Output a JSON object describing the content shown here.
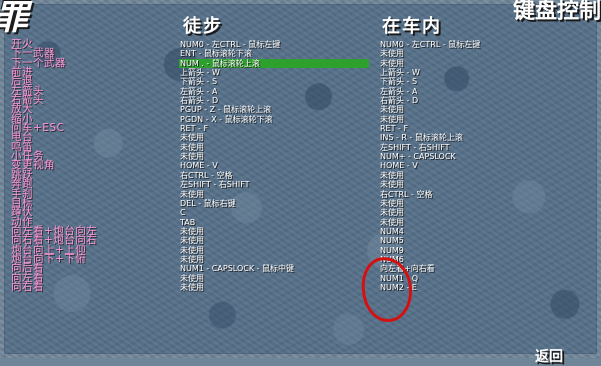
{
  "logo_text": "罪",
  "corner_title": "键盘控制",
  "headers": {
    "on_foot": "徒步",
    "in_vehicle": "在车内"
  },
  "back_label": "返回",
  "colors": {
    "action_text": "#ff96dc",
    "key_text": "#ffffff",
    "selection_highlight": "#2ea02e",
    "annotation_circle": "#d41010"
  },
  "bindings": [
    {
      "action": "开火",
      "on_foot": "NUM0 - 左CTRL - 鼠标左键",
      "in_vehicle": "NUM0 - 左CTRL - 鼠标左键"
    },
    {
      "action": "下一武器",
      "on_foot": "ENT - 鼠标滚轮下滚",
      "in_vehicle": "未使用"
    },
    {
      "action": "下一个武器",
      "on_foot": "NUM . - 鼠标滚轮上滚",
      "in_vehicle": "未使用"
    },
    {
      "action": "前进",
      "on_foot": "上箭头 - W",
      "in_vehicle": "上箭头 - W"
    },
    {
      "action": "后退",
      "on_foot": "下箭头 - S",
      "in_vehicle": "下箭头 - S"
    },
    {
      "action": "左箭头",
      "on_foot": "左箭头 - A",
      "in_vehicle": "左箭头 - A"
    },
    {
      "action": "右箭头",
      "on_foot": "右箭头 - D",
      "in_vehicle": "右箭头 - D"
    },
    {
      "action": "放大",
      "on_foot": "PGUP - Z - 鼠标滚轮上滚",
      "in_vehicle": "未使用"
    },
    {
      "action": "缩小",
      "on_foot": "PGDN - X - 鼠标滚轮下滚",
      "in_vehicle": "未使用"
    },
    {
      "action": "问车+ESC",
      "on_foot": "RET - F",
      "in_vehicle": "RET - F"
    },
    {
      "action": "电台",
      "on_foot": "未使用",
      "in_vehicle": "INS - R - 鼠标滚轮上滚"
    },
    {
      "action": "鸣笛",
      "on_foot": "未使用",
      "in_vehicle": "左SHIFT - 右SHIFT"
    },
    {
      "action": "小任务",
      "on_foot": "未使用",
      "in_vehicle": "NUM+ - CAPSLOCK"
    },
    {
      "action": "变更视角",
      "on_foot": "HOME - V",
      "in_vehicle": "HOME - V"
    },
    {
      "action": "跳跃",
      "on_foot": "右CTRL - 空格",
      "in_vehicle": "未使用"
    },
    {
      "action": "奔跑",
      "on_foot": "左SHIFT - 右SHIFT",
      "in_vehicle": "未使用"
    },
    {
      "action": "手刹",
      "on_foot": "未使用",
      "in_vehicle": "右CTRL - 空格"
    },
    {
      "action": "目标",
      "on_foot": "DEL - 鼠标右键",
      "in_vehicle": "未使用"
    },
    {
      "action": "蹲伏",
      "on_foot": "C",
      "in_vehicle": "未使用"
    },
    {
      "action": "动作",
      "on_foot": "TAB",
      "in_vehicle": "未使用"
    },
    {
      "action": "向左看+炮台向左",
      "on_foot": "未使用",
      "in_vehicle": "NUM4"
    },
    {
      "action": "向右看+炮台向右",
      "on_foot": "未使用",
      "in_vehicle": "NUM5"
    },
    {
      "action": "炮台向上+上仰",
      "on_foot": "未使用",
      "in_vehicle": "NUM9"
    },
    {
      "action": "炮台向下+下俯",
      "on_foot": "未使用",
      "in_vehicle": "NUM6"
    },
    {
      "action": "向后看",
      "on_foot": "NUM1 - CAPSLOCK - 鼠标中键",
      "in_vehicle": "向左看+向右看"
    },
    {
      "action": "向左看",
      "on_foot": "未使用",
      "in_vehicle": "NUM1 - Q"
    },
    {
      "action": "向右看",
      "on_foot": "未使用",
      "in_vehicle": "NUM2 - E"
    }
  ]
}
